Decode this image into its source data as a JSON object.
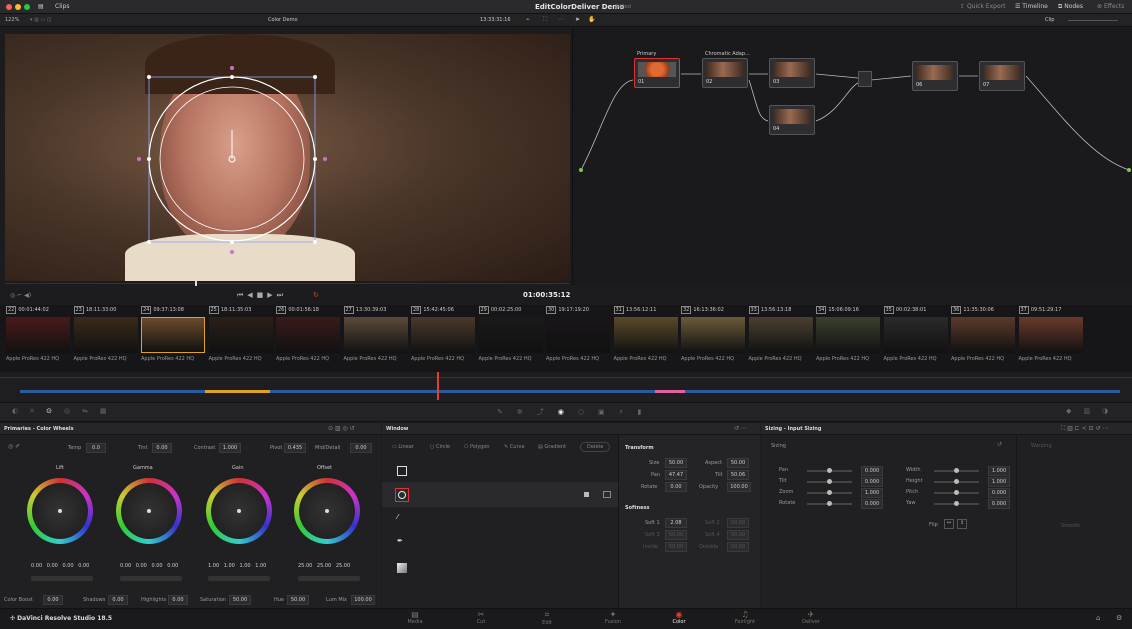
{
  "titlebar": {
    "menu": "Clips",
    "project": "EditColorDeliver Demo",
    "status": "Edited",
    "quick_export": "Quick Export",
    "timeline": "Timeline",
    "nodes": "Nodes",
    "effects": "Effects"
  },
  "viewer_bar": {
    "zoom": "122%",
    "clip_name": "Color Demo",
    "timecode": "13:33:31:16",
    "node_mode": "Clip"
  },
  "viewer": {
    "timecode": "01:00:35:12"
  },
  "nodes": {
    "primary_label": "Primary",
    "chromatic_label": "Chromatic Adap...",
    "n1": "01",
    "n2": "02",
    "n3": "03",
    "n4": "04",
    "n6": "06",
    "n7": "07"
  },
  "clips": [
    {
      "num": "22",
      "tc": "00:01:44:02",
      "label": "Apple ProRes 422 HQ"
    },
    {
      "num": "23",
      "tc": "18:11:33:00",
      "label": "Apple ProRes 422 HQ"
    },
    {
      "num": "24",
      "tc": "09:37:13:08",
      "label": "Apple ProRes 422 HQ"
    },
    {
      "num": "25",
      "tc": "18:11:35:03",
      "label": "Apple ProRes 422 HQ"
    },
    {
      "num": "26",
      "tc": "00:01:56:18",
      "label": "Apple ProRes 422 HQ"
    },
    {
      "num": "27",
      "tc": "13:30:39:03",
      "label": "Apple ProRes 422 HQ"
    },
    {
      "num": "28",
      "tc": "15:42:45:06",
      "label": "Apple ProRes 422 HQ"
    },
    {
      "num": "29",
      "tc": "00:02:25:00",
      "label": "Apple ProRes 422 HQ"
    },
    {
      "num": "30",
      "tc": "19:17:19:20",
      "label": "Apple ProRes 422 HQ"
    },
    {
      "num": "31",
      "tc": "13:56:12:11",
      "label": "Apple ProRes 422 HQ"
    },
    {
      "num": "32",
      "tc": "16:13:36:02",
      "label": "Apple ProRes 422 HQ"
    },
    {
      "num": "33",
      "tc": "13:56:13:18",
      "label": "Apple ProRes 422 HQ"
    },
    {
      "num": "34",
      "tc": "15:06:09:16",
      "label": "Apple ProRes 422 HQ"
    },
    {
      "num": "35",
      "tc": "00:02:38:01",
      "label": "Apple ProRes 422 HQ"
    },
    {
      "num": "36",
      "tc": "11:35:30:06",
      "label": "Apple ProRes 422 HQ"
    },
    {
      "num": "37",
      "tc": "09:51:29:17",
      "label": "Apple ProRes 422 HQ"
    }
  ],
  "primaries": {
    "title": "Primaries - Color Wheels",
    "temp_l": "Temp",
    "temp_v": "0.0",
    "tint_l": "Tint",
    "tint_v": "0.00",
    "contrast_l": "Contrast",
    "contrast_v": "1.000",
    "pivot_l": "Pivot",
    "pivot_v": "0.435",
    "middetail_l": "Mid/Detail",
    "middetail_v": "0.00",
    "wheels": [
      {
        "name": "Lift",
        "vals": [
          "0.00",
          "0.00",
          "0.00",
          "0.00"
        ]
      },
      {
        "name": "Gamma",
        "vals": [
          "0.00",
          "0.00",
          "0.00",
          "0.00"
        ]
      },
      {
        "name": "Gain",
        "vals": [
          "1.00",
          "1.00",
          "1.00",
          "1.00"
        ]
      },
      {
        "name": "Offset",
        "vals": [
          "25.00",
          "25.00",
          "25.00"
        ]
      }
    ],
    "colorboost_l": "Color Boost",
    "colorboost_v": "0.00",
    "shadows_l": "Shadows",
    "shadows_v": "0.00",
    "highlights_l": "Highlights",
    "highlights_v": "0.00",
    "saturation_l": "Saturation",
    "saturation_v": "50.00",
    "hue_l": "Hue",
    "hue_v": "50.00",
    "lummix_l": "Lum Mix",
    "lummix_v": "100.00"
  },
  "window": {
    "title": "Window",
    "linear": "Linear",
    "circle": "Circle",
    "polygon": "Polygon",
    "curve": "Curve",
    "gradient": "Gradient",
    "delete": "Delete"
  },
  "transform": {
    "title": "Transform",
    "size_l": "Size",
    "size_v": "50.00",
    "aspect_l": "Aspect",
    "aspect_v": "50.00",
    "pan_l": "Pan",
    "pan_v": "47.47",
    "tilt_l": "Tilt",
    "tilt_v": "50.06",
    "rotate_l": "Rotate",
    "rotate_v": "0.00",
    "opacity_l": "Opacity",
    "opacity_v": "100.00",
    "softness_title": "Softness",
    "soft1_l": "Soft 1",
    "soft1_v": "2.08",
    "soft2_l": "Soft 2",
    "soft2_v": "50.00",
    "soft3_l": "Soft 3",
    "soft3_v": "50.00",
    "soft4_l": "Soft 4",
    "soft4_v": "50.00",
    "inside_l": "Inside",
    "inside_v": "50.00",
    "outside_l": "Outside",
    "outside_v": "50.00"
  },
  "sizing": {
    "title": "Sizing - Input Sizing",
    "section": "Sizing",
    "pan_l": "Pan",
    "pan_v": "0.000",
    "tilt_l": "Tilt",
    "tilt_v": "0.000",
    "zoom_l": "Zoom",
    "zoom_v": "1.000",
    "rotate_l": "Rotate",
    "rotate_v": "0.000",
    "width_l": "Width",
    "width_v": "1.000",
    "height_l": "Height",
    "height_v": "1.000",
    "pitch_l": "Pitch",
    "pitch_v": "0.000",
    "yaw_l": "Yaw",
    "yaw_v": "0.000",
    "flip_l": "Flip",
    "warping": "Warping",
    "smooth": "Smooth"
  },
  "bottom": {
    "app": "DaVinci Resolve Studio 18.5",
    "pages": [
      "Media",
      "Cut",
      "Edit",
      "Fusion",
      "Color",
      "Fairlight",
      "Deliver"
    ],
    "active_page": "Color"
  },
  "colors": {
    "accent": "#e0402e",
    "bg": "#1c1c1e",
    "node_border_sel": "#d33"
  }
}
